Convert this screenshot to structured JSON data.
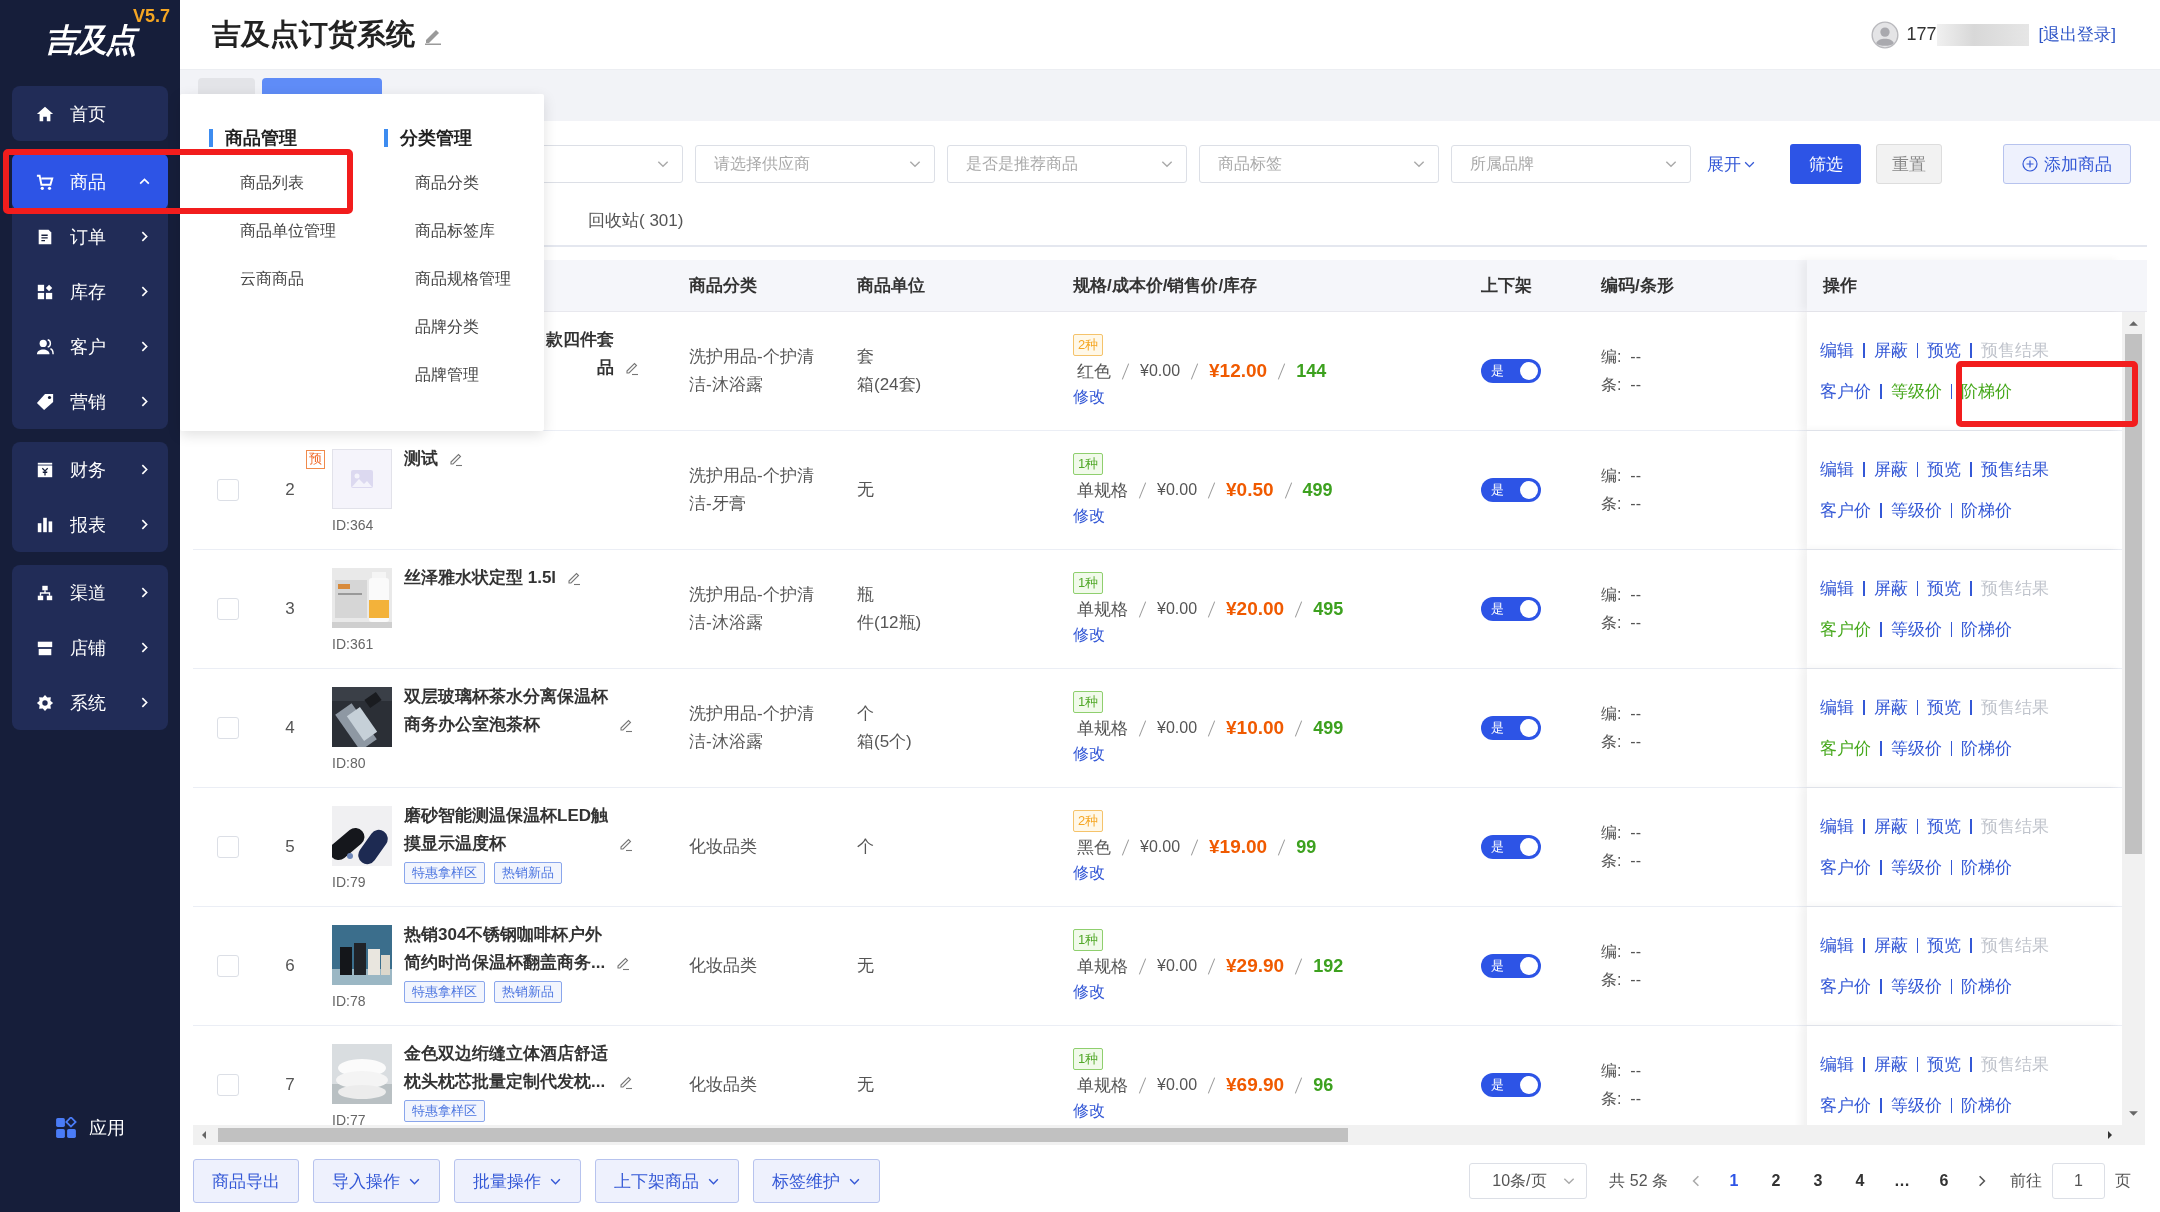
{
  "app": {
    "logo": "吉及点",
    "version": "V5.7"
  },
  "sidebar": {
    "groups": [
      [
        {
          "label": "首页",
          "selected": false
        }
      ],
      [
        {
          "label": "商品",
          "selected": true,
          "expanded": true
        },
        {
          "label": "订单",
          "selected": false,
          "expanded": false
        },
        {
          "label": "库存",
          "selected": false,
          "expanded": false
        },
        {
          "label": "客户",
          "selected": false,
          "expanded": false
        },
        {
          "label": "营销",
          "selected": false,
          "expanded": false
        }
      ],
      [
        {
          "label": "财务",
          "selected": false,
          "expanded": false
        },
        {
          "label": "报表",
          "selected": false,
          "expanded": false
        }
      ],
      [
        {
          "label": "渠道",
          "selected": false,
          "expanded": false
        },
        {
          "label": "店铺",
          "selected": false,
          "expanded": false
        },
        {
          "label": "系统",
          "selected": false,
          "expanded": false
        }
      ]
    ],
    "apps_label": "应用"
  },
  "header": {
    "title": "吉及点订货系统",
    "user": "177",
    "logout": "[退出登录]"
  },
  "tabs": [
    {
      "selected": false
    },
    {
      "selected": true
    }
  ],
  "mega_menu": {
    "columns": [
      {
        "title": "商品管理",
        "items": [
          "商品列表",
          "商品单位管理",
          "云商商品"
        ]
      },
      {
        "title": "分类管理",
        "items": [
          "商品分类",
          "商品标签库",
          "商品规格管理",
          "品牌分类",
          "品牌管理"
        ]
      }
    ]
  },
  "filters": {
    "selects": [
      {
        "placeholder": "请选择供应商"
      },
      {
        "placeholder": "是否是推荐商品"
      },
      {
        "placeholder": "商品标签"
      },
      {
        "placeholder": "所属品牌"
      }
    ],
    "expand": "展开",
    "filter_button": "筛选",
    "reset_button": "重置",
    "add_button": "添加商品"
  },
  "list_tabs": [
    {
      "label": "回收站( 301)",
      "selected": false
    }
  ],
  "columns": [
    "商品分类",
    "商品单位",
    "规格/成本价/销售价/库存",
    "上下架",
    "编码/条形",
    "操作"
  ],
  "rows": [
    {
      "covered": true,
      "name_lines": [
        "款四件套",
        "品"
      ],
      "tags": [],
      "category_lines": [
        "洗护用品-个护清",
        "洁-沐浴露"
      ],
      "unit_lines": [
        "套",
        "箱(24套)"
      ],
      "variant": {
        "label": "2种",
        "kind": "multi"
      },
      "spec": "红色",
      "cost": "¥0.00",
      "price": "¥12.00",
      "stock": "144",
      "edit_link": "修改",
      "on": true,
      "switch_label": "是",
      "code": "编:  --",
      "barcode": "条:  --",
      "ops_top": [
        {
          "label": "编辑",
          "kind": "link"
        },
        {
          "label": "屏蔽",
          "kind": "link"
        },
        {
          "label": "预览",
          "kind": "link"
        },
        {
          "label": "预售结果",
          "kind": "muted"
        }
      ],
      "ops_bottom": [
        {
          "label": "客户价",
          "kind": "link"
        },
        {
          "label": "等级价",
          "kind": "visited"
        },
        {
          "label": "阶梯价",
          "kind": "visited"
        }
      ]
    },
    {
      "covered": false,
      "index": "2",
      "checked": false,
      "presale": "预",
      "image": {
        "kind": "placeholder"
      },
      "id": "ID:364",
      "name_lines": [
        "测试"
      ],
      "tags": [],
      "category_lines": [
        "洗护用品-个护清",
        "洁-牙膏"
      ],
      "unit_lines": [
        "无"
      ],
      "variant": {
        "label": "1种",
        "kind": "single"
      },
      "spec": "单规格",
      "cost": "¥0.00",
      "price": "¥0.50",
      "stock": "499",
      "edit_link": "修改",
      "on": true,
      "switch_label": "是",
      "code": "编:  --",
      "barcode": "条:  --",
      "ops_top": [
        {
          "label": "编辑",
          "kind": "link"
        },
        {
          "label": "屏蔽",
          "kind": "link"
        },
        {
          "label": "预览",
          "kind": "link"
        },
        {
          "label": "预售结果",
          "kind": "link"
        }
      ],
      "ops_bottom": [
        {
          "label": "客户价",
          "kind": "link"
        },
        {
          "label": "等级价",
          "kind": "link"
        },
        {
          "label": "阶梯价",
          "kind": "link"
        }
      ]
    },
    {
      "covered": false,
      "index": "3",
      "checked": false,
      "image": {
        "kind": "picture"
      },
      "id": "ID:361",
      "name_lines": [
        "丝泽雅水状定型 1.5l"
      ],
      "tags": [],
      "category_lines": [
        "洗护用品-个护清",
        "洁-沐浴露"
      ],
      "unit_lines": [
        "瓶",
        "件(12瓶)"
      ],
      "variant": {
        "label": "1种",
        "kind": "single"
      },
      "spec": "单规格",
      "cost": "¥0.00",
      "price": "¥20.00",
      "stock": "495",
      "edit_link": "修改",
      "on": true,
      "switch_label": "是",
      "code": "编:  --",
      "barcode": "条:  --",
      "ops_top": [
        {
          "label": "编辑",
          "kind": "link"
        },
        {
          "label": "屏蔽",
          "kind": "link"
        },
        {
          "label": "预览",
          "kind": "link"
        },
        {
          "label": "预售结果",
          "kind": "muted"
        }
      ],
      "ops_bottom": [
        {
          "label": "客户价",
          "kind": "visited"
        },
        {
          "label": "等级价",
          "kind": "link"
        },
        {
          "label": "阶梯价",
          "kind": "link"
        }
      ]
    },
    {
      "covered": false,
      "index": "4",
      "checked": false,
      "image": {
        "kind": "picture"
      },
      "id": "ID:80",
      "name_lines": [
        "双层玻璃杯茶水分离保温杯",
        "商务办公室泡茶杯"
      ],
      "tags": [],
      "category_lines": [
        "洗护用品-个护清",
        "洁-沐浴露"
      ],
      "unit_lines": [
        "个",
        "箱(5个)"
      ],
      "variant": {
        "label": "1种",
        "kind": "single"
      },
      "spec": "单规格",
      "cost": "¥0.00",
      "price": "¥10.00",
      "stock": "499",
      "edit_link": "修改",
      "on": true,
      "switch_label": "是",
      "code": "编:  --",
      "barcode": "条:  --",
      "ops_top": [
        {
          "label": "编辑",
          "kind": "link"
        },
        {
          "label": "屏蔽",
          "kind": "link"
        },
        {
          "label": "预览",
          "kind": "link"
        },
        {
          "label": "预售结果",
          "kind": "muted"
        }
      ],
      "ops_bottom": [
        {
          "label": "客户价",
          "kind": "visited"
        },
        {
          "label": "等级价",
          "kind": "link"
        },
        {
          "label": "阶梯价",
          "kind": "link"
        }
      ]
    },
    {
      "covered": false,
      "index": "5",
      "checked": false,
      "image": {
        "kind": "picture"
      },
      "id": "ID:79",
      "name_lines": [
        "磨砂智能测温保温杯LED触",
        "摸显示温度杯"
      ],
      "tags": [
        "特惠拿样区",
        "热销新品"
      ],
      "category_lines": [
        "化妆品类"
      ],
      "unit_lines": [
        "个"
      ],
      "variant": {
        "label": "2种",
        "kind": "multi"
      },
      "spec": "黑色",
      "cost": "¥0.00",
      "price": "¥19.00",
      "stock": "99",
      "edit_link": "修改",
      "on": true,
      "switch_label": "是",
      "code": "编:  --",
      "barcode": "条:  --",
      "ops_top": [
        {
          "label": "编辑",
          "kind": "link"
        },
        {
          "label": "屏蔽",
          "kind": "link"
        },
        {
          "label": "预览",
          "kind": "link"
        },
        {
          "label": "预售结果",
          "kind": "muted"
        }
      ],
      "ops_bottom": [
        {
          "label": "客户价",
          "kind": "link"
        },
        {
          "label": "等级价",
          "kind": "link"
        },
        {
          "label": "阶梯价",
          "kind": "link"
        }
      ]
    },
    {
      "covered": false,
      "index": "6",
      "checked": false,
      "image": {
        "kind": "picture"
      },
      "id": "ID:78",
      "name_lines": [
        "热销304不锈钢咖啡杯户外",
        "简约时尚保温杯翻盖商务..."
      ],
      "tags": [
        "特惠拿样区",
        "热销新品"
      ],
      "category_lines": [
        "化妆品类"
      ],
      "unit_lines": [
        "无"
      ],
      "variant": {
        "label": "1种",
        "kind": "single"
      },
      "spec": "单规格",
      "cost": "¥0.00",
      "price": "¥29.90",
      "stock": "192",
      "edit_link": "修改",
      "on": true,
      "switch_label": "是",
      "code": "编:  --",
      "barcode": "条:  --",
      "ops_top": [
        {
          "label": "编辑",
          "kind": "link"
        },
        {
          "label": "屏蔽",
          "kind": "link"
        },
        {
          "label": "预览",
          "kind": "link"
        },
        {
          "label": "预售结果",
          "kind": "muted"
        }
      ],
      "ops_bottom": [
        {
          "label": "客户价",
          "kind": "link"
        },
        {
          "label": "等级价",
          "kind": "link"
        },
        {
          "label": "阶梯价",
          "kind": "link"
        }
      ]
    },
    {
      "covered": false,
      "index": "7",
      "checked": false,
      "image": {
        "kind": "picture"
      },
      "id": "ID:77",
      "name_lines": [
        "金色双边绗缝立体酒店舒适",
        "枕头枕芯批量定制代发枕..."
      ],
      "tags": [
        "特惠拿样区"
      ],
      "category_lines": [
        "化妆品类"
      ],
      "unit_lines": [
        "无"
      ],
      "variant": {
        "label": "1种",
        "kind": "single"
      },
      "spec": "单规格",
      "cost": "¥0.00",
      "price": "¥69.90",
      "stock": "96",
      "edit_link": "修改",
      "on": true,
      "switch_label": "是",
      "code": "编:  --",
      "barcode": "条:  --",
      "ops_top": [
        {
          "label": "编辑",
          "kind": "link"
        },
        {
          "label": "屏蔽",
          "kind": "link"
        },
        {
          "label": "预览",
          "kind": "link"
        },
        {
          "label": "预售结果",
          "kind": "muted"
        }
      ],
      "ops_bottom": [
        {
          "label": "客户价",
          "kind": "link"
        },
        {
          "label": "等级价",
          "kind": "link"
        },
        {
          "label": "阶梯价",
          "kind": "link"
        }
      ]
    }
  ],
  "footer": {
    "buttons": [
      {
        "label": "商品导出",
        "dropdown": false
      },
      {
        "label": "导入操作",
        "dropdown": true
      },
      {
        "label": "批量操作",
        "dropdown": true
      },
      {
        "label": "上下架商品",
        "dropdown": true
      },
      {
        "label": "标签维护",
        "dropdown": true
      }
    ],
    "page_size": "10条/页",
    "total": "共 52 条",
    "pages": [
      {
        "label": "1",
        "selected": true
      },
      {
        "label": "2",
        "selected": false
      },
      {
        "label": "3",
        "selected": false
      },
      {
        "label": "4",
        "selected": false
      },
      {
        "label": "…",
        "selected": false
      },
      {
        "label": "6",
        "selected": false
      }
    ],
    "goto_label": "前往",
    "goto_value": "1",
    "page_suffix": "页"
  }
}
